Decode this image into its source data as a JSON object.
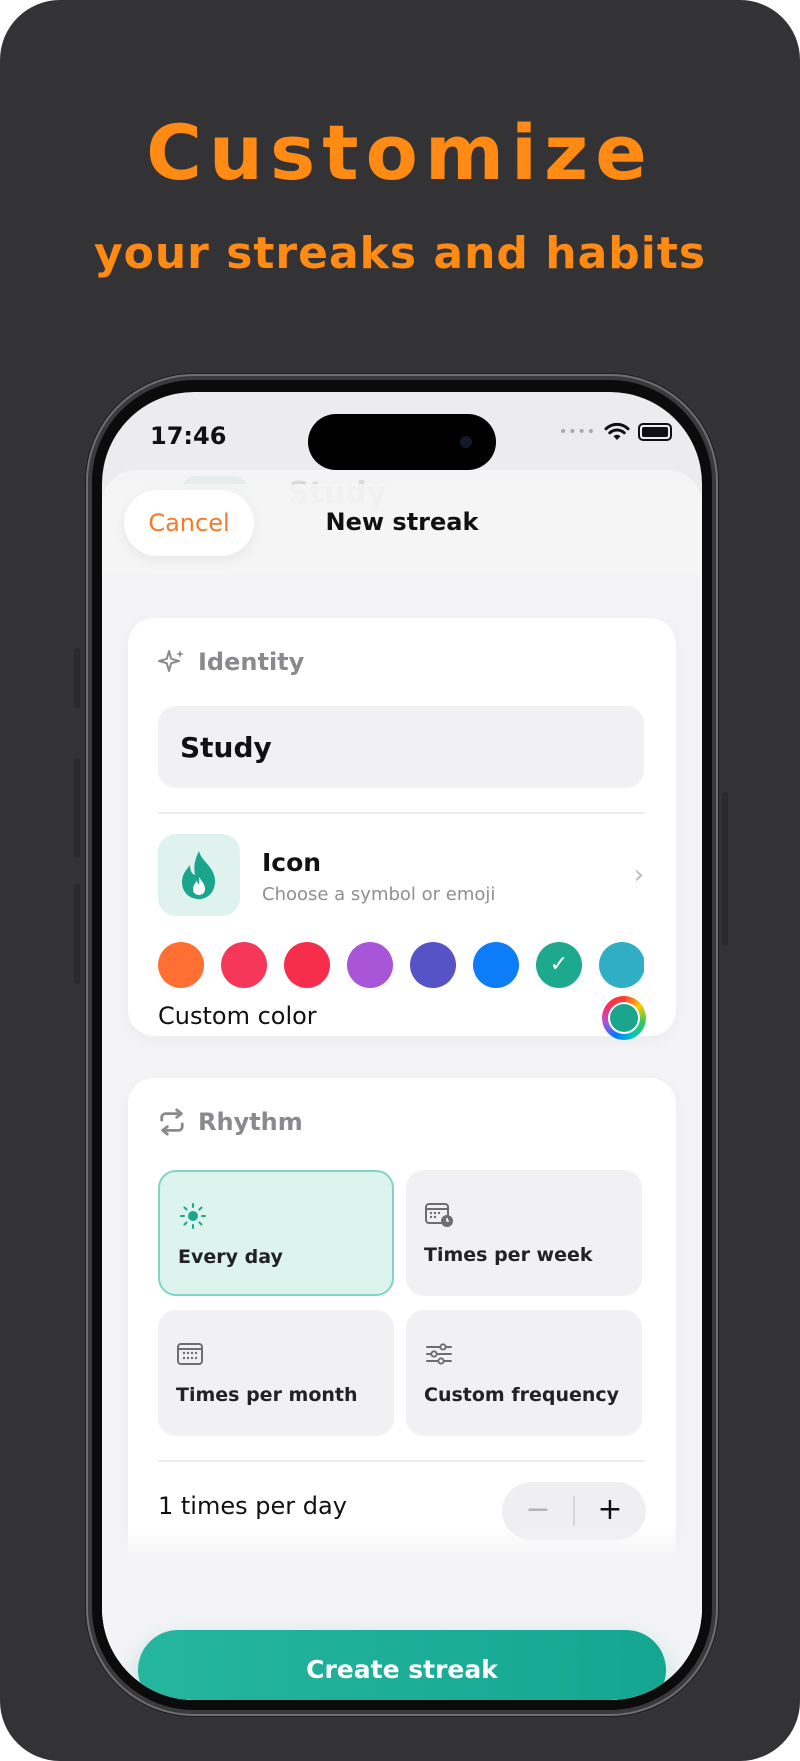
{
  "promo": {
    "headline": "Customize",
    "subheadline": "your streaks and habits"
  },
  "status_bar": {
    "time": "17:46",
    "signal": "••••",
    "wifi_icon": "wifi-icon",
    "battery_icon": "battery-icon"
  },
  "background_sheet": {
    "title": "Study"
  },
  "nav": {
    "cancel_label": "Cancel",
    "title": "New streak"
  },
  "identity": {
    "section_icon": "sparkles-icon",
    "section_label": "Identity",
    "name_value": "Study",
    "icon_title": "Icon",
    "icon_subtitle": "Choose a symbol or emoji",
    "chevron": "›",
    "selected_icon": "flame-icon",
    "colors": [
      "#ff6f33",
      "#f53759",
      "#f72d4c",
      "#a855d8",
      "#5553c6",
      "#0d7cf8",
      "#1ca98e",
      "#30afc4"
    ],
    "selected_color": "#1ca98e",
    "selected_mark": "✓",
    "custom_color_label": "Custom color"
  },
  "rhythm": {
    "section_icon": "repeat-icon",
    "section_label": "Rhythm",
    "options": [
      {
        "label": "Every day",
        "icon": "sun-icon",
        "selected": true
      },
      {
        "label": "Times per week",
        "icon": "calendar-badge-icon",
        "selected": false
      },
      {
        "label": "Times per month",
        "icon": "calendar-icon",
        "selected": false
      },
      {
        "label": "Custom frequency",
        "icon": "sliders-icon",
        "selected": false
      }
    ],
    "per_day_text": "1 times per day",
    "stepper_minus": "−",
    "stepper_plus": "+"
  },
  "primary_action": {
    "label": "Create streak"
  },
  "colors": {
    "accent_orange": "#ff8a14",
    "teal": "#1aa58c",
    "poster_bg": "#333335"
  }
}
